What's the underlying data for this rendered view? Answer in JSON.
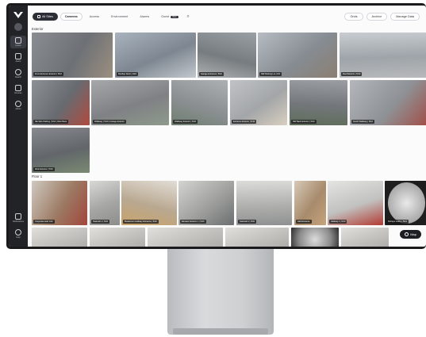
{
  "sidebar": {
    "items": [
      {
        "label": "Home",
        "icon": "home-icon"
      },
      {
        "label": "Alerts",
        "icon": "bell-icon"
      },
      {
        "label": "Search",
        "icon": "search-icon"
      },
      {
        "label": "Devices",
        "icon": "camera-icon"
      },
      {
        "label": "Admin",
        "icon": "gear-icon"
      }
    ],
    "bottom": [
      {
        "label": "Notifications",
        "icon": "bell-icon"
      },
      {
        "label": "Help",
        "icon": "help-icon"
      }
    ]
  },
  "topbar": {
    "all_sites": "All Sites",
    "tabs": [
      "Cameras",
      "Access",
      "Environment",
      "Alarms",
      "Guest"
    ],
    "new_badge": "New",
    "right_buttons": [
      "Grids",
      "Archive",
      "Manage Data"
    ]
  },
  "sections": {
    "exterior": "Exterior",
    "floor1": "Floor 1"
  },
  "exterior_tiles": [
    "Front Entrance Exterior | 5/10",
    "Rooftop Deck | 4/16",
    "Garage Entrance | 5/10",
    "NW Parking Lot | 6/4",
    "Roof Exterior | 5/10",
    "NE Side Parking | 5/10 | Wet Plaza",
    "Walkway | 5/10 | Garage Exterior",
    "Walkway Exterior | 5/10",
    "Entrance Exterior | 5/10",
    "NW Back Exterior | 5/10",
    "South Walkway | 5/10",
    "West Exterior | 5/10"
  ],
  "floor1_tiles": [
    "Corporate Hall 1/10",
    "Stairwell 1 | 5/10",
    "Breakroom Hallway Entrance | 5/10",
    "Elevator Exterior 1 | 5/10",
    "Stairwell 2 | 5/10",
    "Hall Entrance",
    "Hallway 2 | 5/10",
    "Fisheye Lobby | 5/10"
  ],
  "map_button": "Map",
  "colors": {
    "sidebar": "#222327",
    "accent": "#2c2e35",
    "screen_bg": "#fbfbfb"
  }
}
